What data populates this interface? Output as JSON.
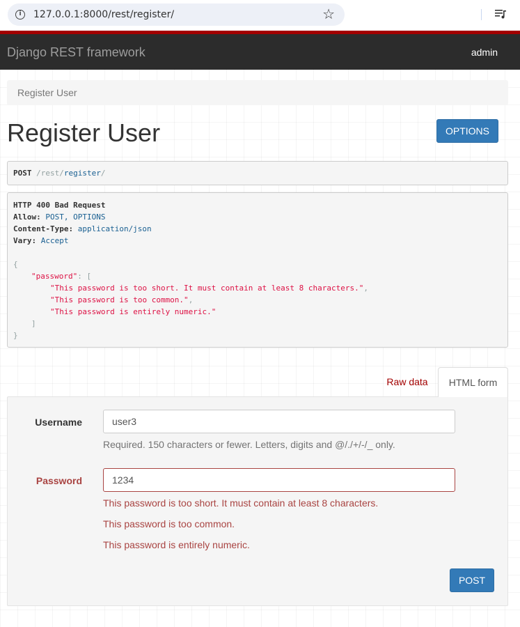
{
  "browser": {
    "url": "127.0.0.1:8000/rest/register/"
  },
  "navbar": {
    "brand": "Django REST framework",
    "user": "admin"
  },
  "breadcrumb": {
    "current": "Register User"
  },
  "page": {
    "title": "Register User",
    "options_label": "OPTIONS"
  },
  "request": {
    "method": "POST",
    "path_prefix": " /rest/",
    "path_link": "register",
    "path_suffix": "/"
  },
  "response": {
    "status": "HTTP 400 Bad Request",
    "allow_label": "Allow:",
    "allow_value": " POST, OPTIONS",
    "content_type_label": "Content-Type:",
    "content_type_value": " application/json",
    "vary_label": "Vary:",
    "vary_value": " Accept",
    "open_brace": "{",
    "password_key": "\"password\"",
    "key_sep": ": [",
    "errors": [
      "\"This password is too short. It must contain at least 8 characters.\"",
      "\"This password is too common.\"",
      "\"This password is entirely numeric.\""
    ],
    "comma": ",",
    "close_bracket": "]",
    "close_brace": "}"
  },
  "tabs": {
    "raw_data": "Raw data",
    "html_form": "HTML form"
  },
  "form": {
    "username_label": "Username",
    "username_value": "user3",
    "username_help": "Required. 150 characters or fewer. Letters, digits and @/./+/-/_ only.",
    "password_label": "Password",
    "password_value": "1234",
    "password_errors": [
      "This password is too short. It must contain at least 8 characters.",
      "This password is too common.",
      "This password is entirely numeric."
    ],
    "submit_label": "POST"
  },
  "colors": {
    "navbar": "#2c2c2c",
    "accent_red": "#a30000",
    "button_blue": "#337ab7",
    "error_red": "#a94442"
  },
  "icons": [
    "info-icon",
    "star-icon",
    "playlist-icon"
  ]
}
